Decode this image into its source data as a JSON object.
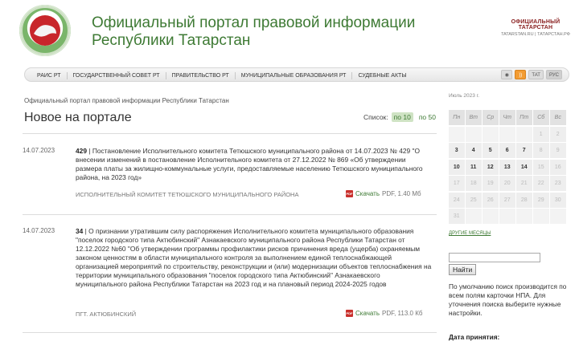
{
  "header": {
    "title_line1": "Официальный портал правовой информации",
    "title_line2": "Республики Татарстан",
    "logo_text": "ОФИЦИАЛЬНЫЙ ТАТАРСТАН",
    "logo_sub": "TATARSTAN.RU | ТАТАРСТАН.РФ"
  },
  "nav": {
    "items": [
      {
        "label": "РАИС РТ"
      },
      {
        "label": "ГОСУДАРСТВЕННЫЙ СОВЕТ РТ"
      },
      {
        "label": "ПРАВИТЕЛЬСТВО РТ"
      },
      {
        "label": "МУНИЦИПАЛЬНЫЕ ОБРАЗОВАНИЯ РТ"
      },
      {
        "label": "СУДЕБНЫЕ АКТЫ"
      }
    ],
    "lang_tat": "ТАТ",
    "lang_rus": "РУС"
  },
  "breadcrumb": "Официальный портал правовой информации Республики Татарстан",
  "page_title": "Новое на портале",
  "list_switch": {
    "label": "Список:",
    "opt10": "по 10",
    "opt50": "по 50"
  },
  "entries": [
    {
      "date": "14.07.2023",
      "number": "429",
      "text": " | Постановление Исполнительного комитета Тетюшского муниципального района от 14.07.2023 № 429 \"О внесении изменений в постановление Исполнительного комитета от 27.12.2022 № 869 «Об утверждении размера платы за жилищно-коммунальные услуги, предоставляемые населению Тетюшского муниципального района, на 2023 год»",
      "org": "ИСПОЛНИТЕЛЬНЫЙ КОМИТЕТ ТЕТЮШСКОГО МУНИЦИПАЛЬНОГО РАЙОНА",
      "download": "Скачать",
      "filesize": "PDF, 1.40 Мб"
    },
    {
      "date": "14.07.2023",
      "number": "34",
      "text": " | О признании утратившим силу распоряжения Исполнительного комитета муниципального образования \"поселок городского типа Актюбинский\" Азнакаевского муниципального района Республики Татарстан от 12.12.2022 №60 \"Об утверждении программы профилактики рисков причинения вреда (ущерба) охраняемым законом ценностям в области муниципального контроля за выполнением единой теплоснабжающей организацией мероприятий по строительству, реконструкции и (или) модернизации объектов теплоснабжения на территории муниципального образования \"поселок городского типа Актюбинский\" Азнакаевского муниципального района Республики Татарстан на 2023 год и на плановый период 2024-2025 годов",
      "org": "ПГТ. АКТЮБИНСКИЙ",
      "download": "Скачать",
      "filesize": "PDF, 113.0 Кб"
    }
  ],
  "calendar": {
    "title": "Июль 2023 г.",
    "weekdays": [
      "Пн",
      "Вт",
      "Ср",
      "Чт",
      "Пт",
      "Сб",
      "Вс"
    ],
    "days": [
      "",
      "",
      "",
      "",
      "",
      "1",
      "2",
      "3",
      "4",
      "5",
      "6",
      "7",
      "8",
      "9",
      "10",
      "11",
      "12",
      "13",
      "14",
      "15",
      "16",
      "17",
      "18",
      "19",
      "20",
      "21",
      "22",
      "23",
      "24",
      "25",
      "26",
      "27",
      "28",
      "29",
      "30",
      "31",
      "",
      "",
      "",
      "",
      "",
      ""
    ],
    "active_days": [
      "3",
      "4",
      "5",
      "6",
      "7",
      "10",
      "11",
      "12",
      "13",
      "14"
    ],
    "other_months": "ДРУГИЕ МЕСЯЦЫ"
  },
  "search": {
    "button": "Найти",
    "hint": "По умолчанию поиск производится по всем полям карточки НПА. Для уточнения поиска выберите нужные настройки.",
    "date_label": "Дата принятия:"
  }
}
